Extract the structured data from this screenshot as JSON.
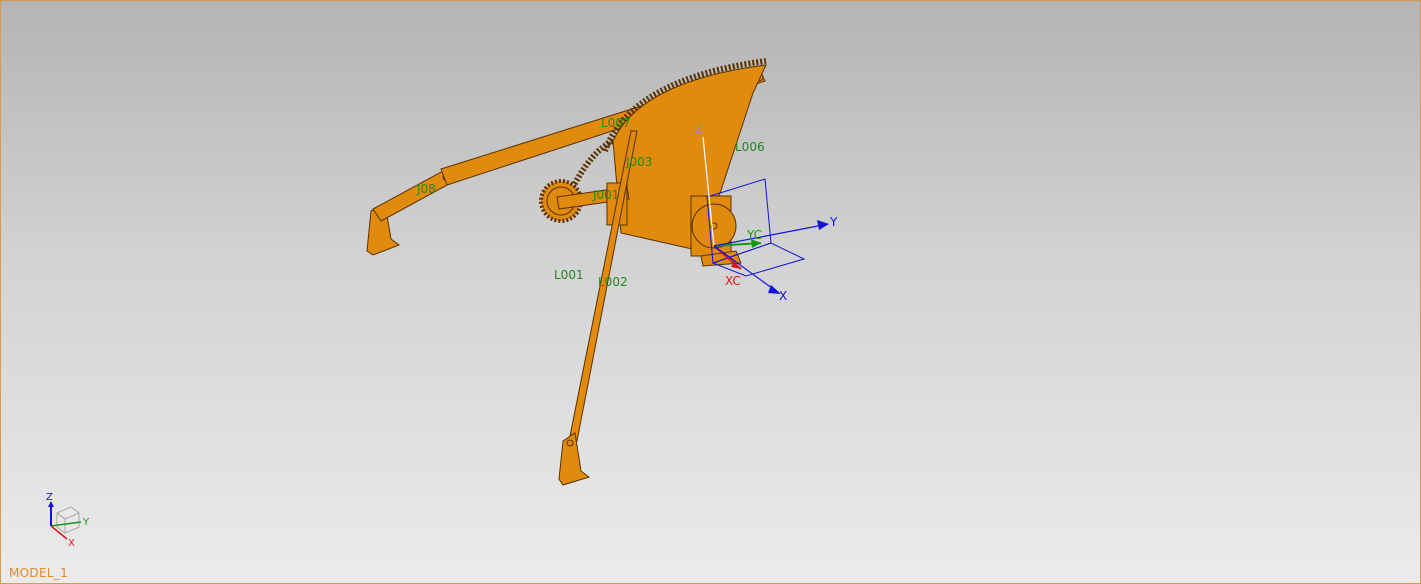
{
  "window": {
    "model_name": "MODEL_1"
  },
  "labels": {
    "link_1": "L001",
    "link_2": "L002",
    "link_7": "L007",
    "link_6": "L006",
    "joint_3": "J003",
    "joint_8": "J08",
    "joint_1": "J001"
  },
  "wcs": {
    "x": "X",
    "y": "Y",
    "z": "Z",
    "xc": "XC",
    "yc": "YC"
  },
  "triad": {
    "x": "X",
    "y": "Y",
    "z": "Z"
  },
  "colors": {
    "part": "#e08a0e",
    "part_edge": "#5a3200",
    "label_green": "#1e8a1e",
    "axis_blue": "#1212d8",
    "axis_red": "#d41818",
    "axis_green": "#139a13",
    "frame_border": "#d89a50"
  }
}
